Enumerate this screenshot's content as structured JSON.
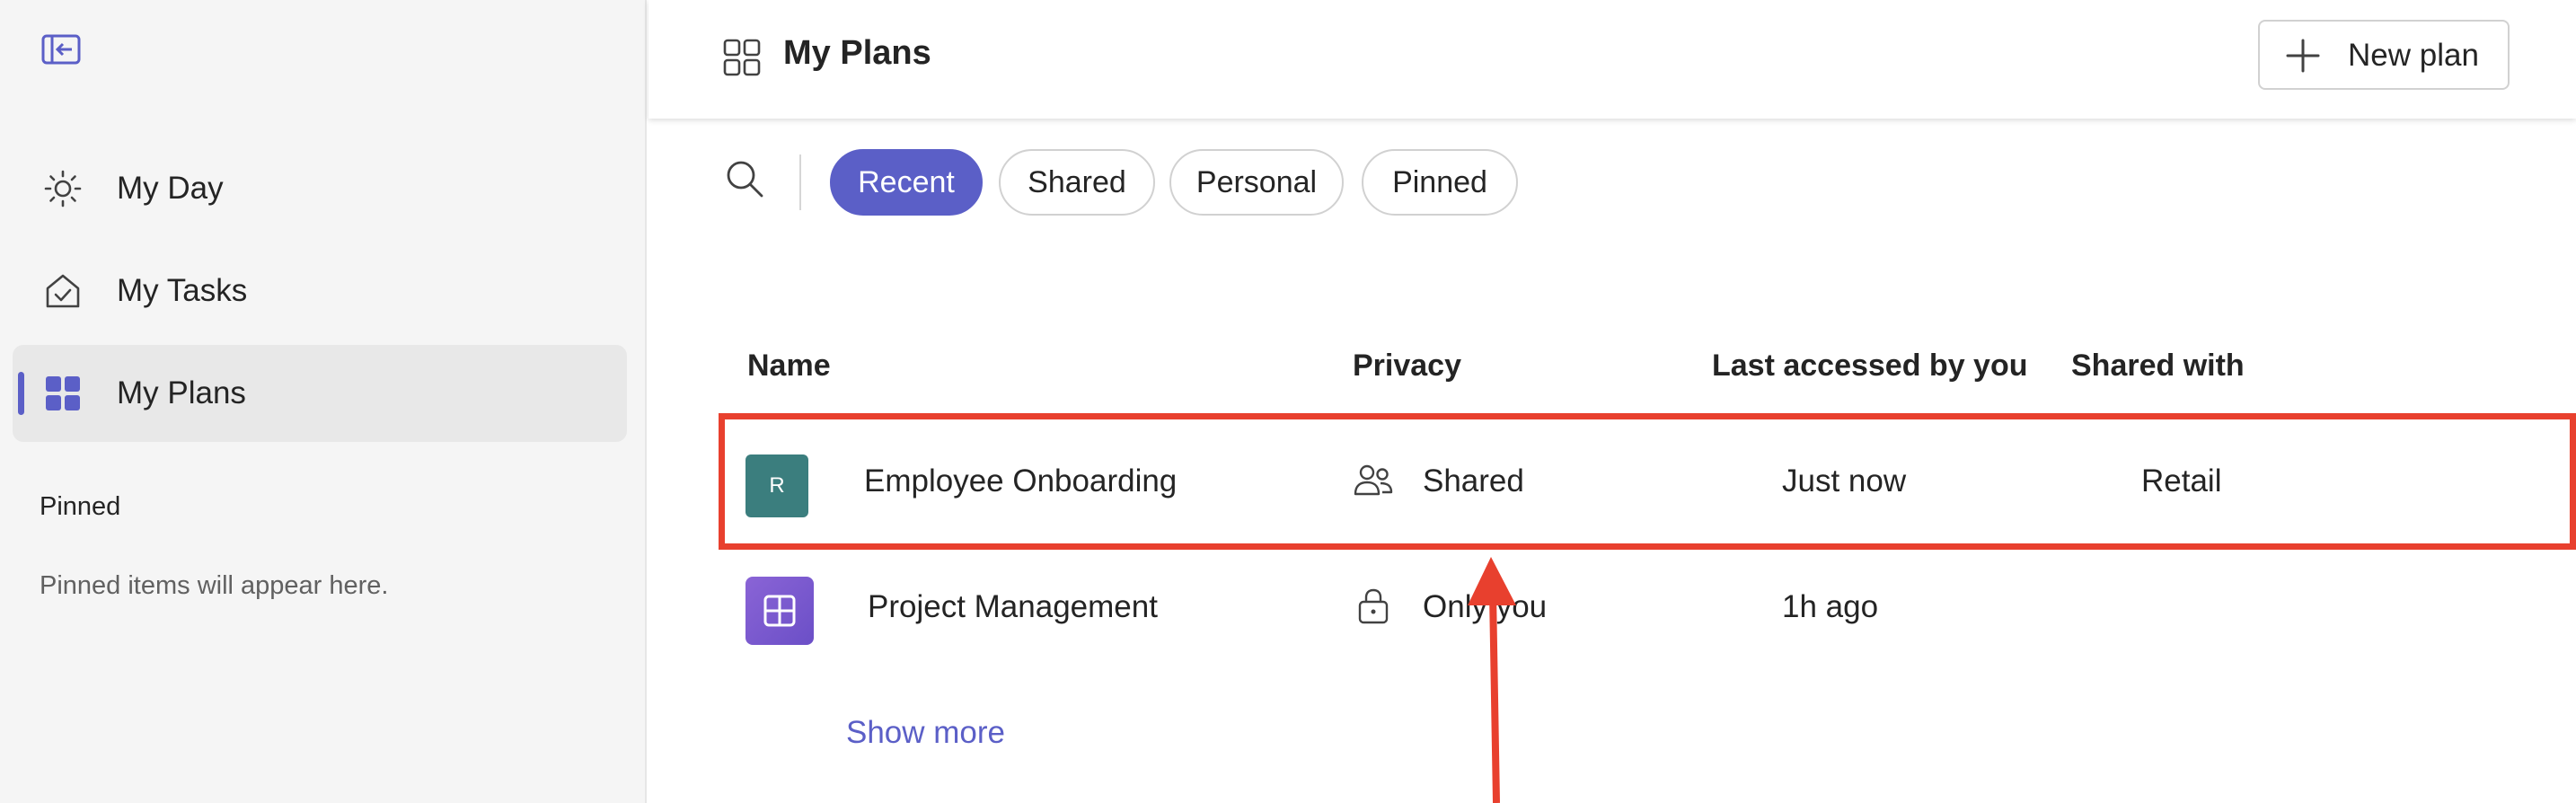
{
  "sidebar": {
    "collapse_icon": "panel-collapse-icon",
    "items": [
      {
        "label": "My Day",
        "icon": "sun-icon"
      },
      {
        "label": "My Tasks",
        "icon": "home-check-icon"
      },
      {
        "label": "My Plans",
        "icon": "grid-icon",
        "active": true
      }
    ],
    "pinned_heading": "Pinned",
    "pinned_empty": "Pinned items will appear here."
  },
  "header": {
    "title": "My Plans",
    "icon": "grid-outline-icon",
    "new_plan_label": "New plan"
  },
  "filters": {
    "search_icon": "search-icon",
    "pills": [
      {
        "label": "Recent",
        "active": true
      },
      {
        "label": "Shared",
        "active": false
      },
      {
        "label": "Personal",
        "active": false
      },
      {
        "label": "Pinned",
        "active": false
      }
    ]
  },
  "table": {
    "columns": [
      "Name",
      "Privacy",
      "Last accessed by you",
      "Shared with"
    ],
    "rows": [
      {
        "avatar_letter": "R",
        "name": "Employee Onboarding",
        "privacy": "Shared",
        "privacy_icon": "people-icon",
        "last_accessed": "Just now",
        "shared_with": "Retail"
      },
      {
        "avatar_letter": "",
        "name": "Project Management",
        "privacy": "Only you",
        "privacy_icon": "lock-icon",
        "last_accessed": "1h ago",
        "shared_with": ""
      }
    ],
    "show_more": "Show more"
  },
  "colors": {
    "accent": "#5b5fc7",
    "annotation": "#e8402e",
    "avatar_teal": "#3b7e7e",
    "avatar_purple": "#7a58d0"
  }
}
